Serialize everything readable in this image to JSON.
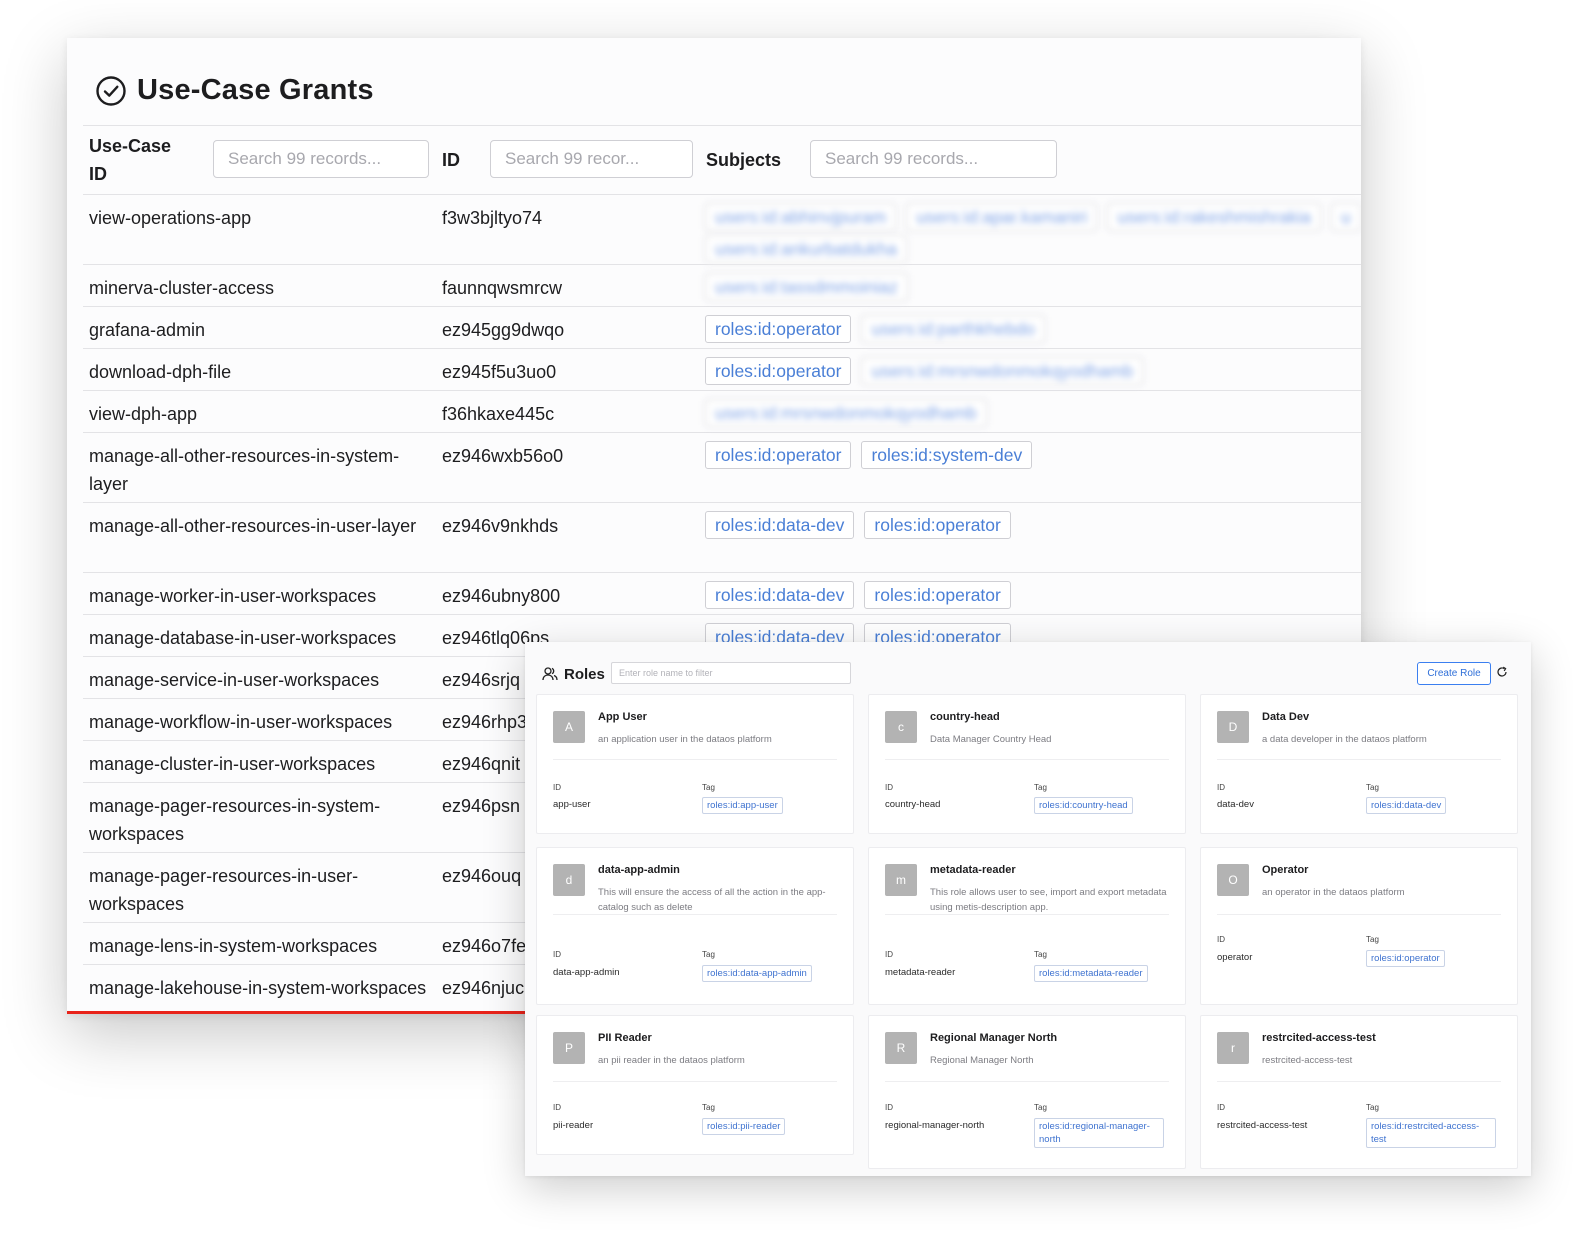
{
  "grants": {
    "title": "Use-Case Grants",
    "columns": {
      "usecase_label": "Use-Case ID",
      "id_label": "ID",
      "subjects_label": "Subjects",
      "usecase_search_placeholder": "Search 99 records...",
      "id_search_placeholder": "Search 99 recor...",
      "subjects_search_placeholder": "Search 99 records..."
    },
    "rows": [
      {
        "usecase": "view-operations-app",
        "id": "f3w3bjltyo74",
        "subjects": [
          {
            "text": "users:id:abhinvjpuram",
            "blurred": true
          },
          {
            "text": "users:id:apar.kamaniri",
            "blurred": true
          },
          {
            "text": "users:id:rakeshmishrakia",
            "blurred": true
          },
          {
            "text": "u",
            "blurred": true
          },
          {
            "text": "users:id:ankurbatdukha",
            "blurred": true
          }
        ]
      },
      {
        "usecase": "minerva-cluster-access",
        "id": "faunnqwsmrcw",
        "subjects": [
          {
            "text": "users:id:tassdmmoiniaz",
            "blurred": true
          }
        ]
      },
      {
        "usecase": "grafana-admin",
        "id": "ez945gg9dwqo",
        "subjects": [
          {
            "text": "roles:id:operator",
            "blurred": false
          },
          {
            "text": "users:id:parthkhebdo",
            "blurred": false,
            "faded": true
          }
        ]
      },
      {
        "usecase": "download-dph-file",
        "id": "ez945f5u3uo0",
        "subjects": [
          {
            "text": "roles:id:operator",
            "blurred": false
          },
          {
            "text": "users:id:mrsnwdonmokqyodhamb",
            "blurred": true
          }
        ]
      },
      {
        "usecase": "view-dph-app",
        "id": "f36hkaxe445c",
        "subjects": [
          {
            "text": "users:id:mrsnwdonmokqyodhamb",
            "blurred": true
          }
        ]
      },
      {
        "usecase": "manage-all-other-resources-in-system-layer",
        "id": "ez946wxb56o0",
        "subjects": [
          {
            "text": "roles:id:operator",
            "blurred": false
          },
          {
            "text": "roles:id:system-dev",
            "blurred": false
          }
        ]
      },
      {
        "usecase": "manage-all-other-resources-in-user-layer",
        "id": "ez946v9nkhds",
        "subjects": [
          {
            "text": "roles:id:data-dev",
            "blurred": false
          },
          {
            "text": "roles:id:operator",
            "blurred": false
          }
        ]
      },
      {
        "usecase": "manage-worker-in-user-workspaces",
        "id": "ez946ubny800",
        "subjects": [
          {
            "text": "roles:id:data-dev",
            "blurred": false
          },
          {
            "text": "roles:id:operator",
            "blurred": false
          }
        ]
      },
      {
        "usecase": "manage-database-in-user-workspaces",
        "id": "ez946tlq06ps",
        "subjects": [
          {
            "text": "roles:id:data-dev",
            "blurred": false
          },
          {
            "text": "roles:id:operator",
            "blurred": false
          }
        ]
      },
      {
        "usecase": "manage-service-in-user-workspaces",
        "id": "ez946srjq",
        "subjects": []
      },
      {
        "usecase": "manage-workflow-in-user-workspaces",
        "id": "ez946rhp3",
        "subjects": []
      },
      {
        "usecase": "manage-cluster-in-user-workspaces",
        "id": "ez946qnit",
        "subjects": []
      },
      {
        "usecase": "manage-pager-resources-in-system-workspaces",
        "id": "ez946psn",
        "subjects": []
      },
      {
        "usecase": "manage-pager-resources-in-user-workspaces",
        "id": "ez946ouq",
        "subjects": []
      },
      {
        "usecase": "manage-lens-in-system-workspaces",
        "id": "ez946o7fe",
        "subjects": []
      },
      {
        "usecase": "manage-lakehouse-in-system-workspaces",
        "id": "ez946njuc",
        "subjects": []
      }
    ]
  },
  "roles": {
    "title": "Roles",
    "filter_placeholder": "Enter role name to filter",
    "create_label": "Create Role",
    "id_label": "ID",
    "tag_label": "Tag",
    "cards": [
      {
        "initial": "A",
        "name": "App User",
        "description": "an application user in the dataos platform",
        "id": "app-user",
        "tag": "roles:id:app-user"
      },
      {
        "initial": "c",
        "name": "country-head",
        "description": "Data Manager Country Head",
        "id": "country-head",
        "tag": "roles:id:country-head"
      },
      {
        "initial": "D",
        "name": "Data Dev",
        "description": "a data developer in the dataos platform",
        "id": "data-dev",
        "tag": "roles:id:data-dev"
      },
      {
        "initial": "d",
        "name": "data-app-admin",
        "description": "This will ensure the access of all the action in the app-catalog such as delete",
        "id": "data-app-admin",
        "tag": "roles:id:data-app-admin"
      },
      {
        "initial": "m",
        "name": "metadata-reader",
        "description": "This role allows user to see, import and export metadata using metis-description app.",
        "id": "metadata-reader",
        "tag": "roles:id:metadata-reader"
      },
      {
        "initial": "O",
        "name": "Operator",
        "description": "an operator in the dataos platform",
        "id": "operator",
        "tag": "roles:id:operator"
      },
      {
        "initial": "P",
        "name": "PII Reader",
        "description": "an pii reader in the dataos platform",
        "id": "pii-reader",
        "tag": "roles:id:pii-reader"
      },
      {
        "initial": "R",
        "name": "Regional Manager North",
        "description": "Regional Manager North",
        "id": "regional-manager-north",
        "tag": "roles:id:regional-manager-north"
      },
      {
        "initial": "r",
        "name": "restrcited-access-test",
        "description": "restrcited-access-test",
        "id": "restrcited-access-test",
        "tag": "roles:id:restrcited-access-test"
      }
    ]
  },
  "colors": {
    "accent": "#4a7fd6",
    "alert_line": "#e8231a",
    "avatar": "#b3b3b3"
  },
  "icons": {
    "grants_title": "check-circle-icon",
    "roles_title": "users-icon",
    "refresh": "refresh-icon"
  }
}
